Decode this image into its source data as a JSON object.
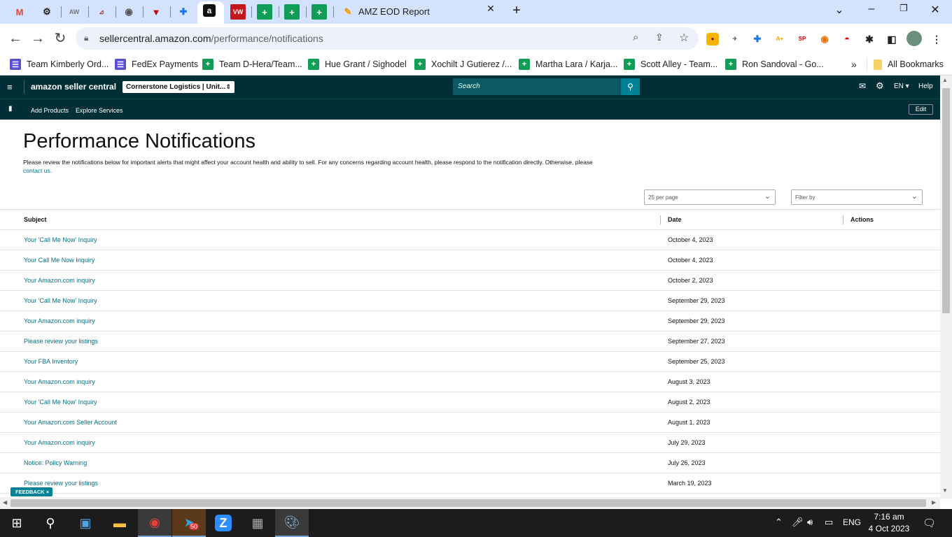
{
  "browser": {
    "last_tab_title": "AMZ EOD Report",
    "url_host": "sellercentral.amazon.com",
    "url_path": "/performance/notifications",
    "bookmarks": [
      {
        "label": "Team Kimberly Ord...",
        "icon": "list-icon"
      },
      {
        "label": "FedEx Payments",
        "icon": "list-icon"
      },
      {
        "label": "Team D-Hera/Team...",
        "icon": "sheets-icon"
      },
      {
        "label": "Hue Grant / Sighodel",
        "icon": "sheets-icon"
      },
      {
        "label": "Xochilt J Gutierez /...",
        "icon": "sheets-icon"
      },
      {
        "label": "Martha Lara / Karja...",
        "icon": "sheets-icon"
      },
      {
        "label": "Scott Alley - Team...",
        "icon": "sheets-icon"
      },
      {
        "label": "Ron Sandoval - Go...",
        "icon": "sheets-icon"
      }
    ],
    "more_bookmarks": "»",
    "all_bookmarks": "All Bookmarks"
  },
  "sc": {
    "logo": "amazon seller central",
    "account": "Cornerstone Logistics | Unit...",
    "search_placeholder": "Search",
    "lang": "EN",
    "help": "Help",
    "nav": [
      "Add Products",
      "Explore Services"
    ],
    "edit": "Edit"
  },
  "page": {
    "title": "Performance Notifications",
    "description": "Please review the notifications below for important alerts that might affect your account health and ability to sell. For any concerns regarding account health, please respond to the notification directly. Otherwise, please",
    "contact_link": "contact us.",
    "per_page": "25 per page",
    "filter_placeholder": "Filter by",
    "columns": {
      "subject": "Subject",
      "date": "Date",
      "actions": "Actions"
    },
    "rows": [
      {
        "subject": "Your 'Call Me Now' Inquiry",
        "date": "October 4, 2023"
      },
      {
        "subject": "Your Call Me Now Inquiry",
        "date": "October 4, 2023"
      },
      {
        "subject": "Your Amazon.com inquiry",
        "date": "October 2, 2023"
      },
      {
        "subject": "Your 'Call Me Now' Inquiry",
        "date": "September 29, 2023"
      },
      {
        "subject": "Your Amazon.com inquiry",
        "date": "September 29, 2023"
      },
      {
        "subject": "Please review your listings",
        "date": "September 27, 2023"
      },
      {
        "subject": "Your FBA Inventory",
        "date": "September 25, 2023"
      },
      {
        "subject": "Your Amazon.com inquiry",
        "date": "August 3, 2023"
      },
      {
        "subject": "Your 'Call Me Now' Inquiry",
        "date": "August 2, 2023"
      },
      {
        "subject": "Your Amazon.com Seller Account",
        "date": "August 1, 2023"
      },
      {
        "subject": "Your Amazon.com inquiry",
        "date": "July 29, 2023"
      },
      {
        "subject": "Notice: Policy Warning",
        "date": "July 26, 2023"
      },
      {
        "subject": "Please review your listings",
        "date": "March 19, 2023"
      }
    ],
    "feedback": "FEEDBACK ×"
  },
  "taskbar": {
    "lang": "ENG",
    "time": "7:16 am",
    "date": "4 Oct 2023",
    "badge": "50"
  },
  "colors": {
    "header_bg": "#002f36",
    "link": "#007185",
    "accent": "#008296"
  }
}
